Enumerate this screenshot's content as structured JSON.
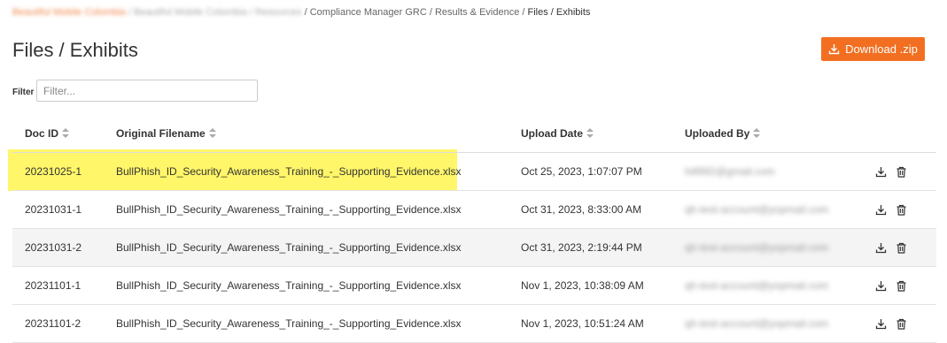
{
  "breadcrumb": {
    "org": "Beautiful Mobile Colombia",
    "client": "Beautiful Mobile Colombia",
    "section": "Resources",
    "path": "/ Compliance Manager GRC / Results & Evidence /",
    "current": "Files / Exhibits"
  },
  "page": {
    "title": "Files / Exhibits",
    "download_label": "Download .zip"
  },
  "filter": {
    "label": "Filter",
    "placeholder": "Filter..."
  },
  "table": {
    "headers": {
      "doc_id": "Doc ID",
      "filename": "Original Filename",
      "upload_date": "Upload Date",
      "uploaded_by": "Uploaded By"
    },
    "rows": [
      {
        "doc_id": "20231025-1",
        "filename": "BullPhish_ID_Security_Awareness_Training_-_Supporting_Evidence.xlsx",
        "upload_date": "Oct 25, 2023, 1:07:07 PM",
        "uploaded_by": "hill992@gmail.com",
        "highlighted": true
      },
      {
        "doc_id": "20231031-1",
        "filename": "BullPhish_ID_Security_Awareness_Training_-_Supporting_Evidence.xlsx",
        "upload_date": "Oct 31, 2023, 8:33:00 AM",
        "uploaded_by": "qh-test-account@yopmail.com"
      },
      {
        "doc_id": "20231031-2",
        "filename": "BullPhish_ID_Security_Awareness_Training_-_Supporting_Evidence.xlsx",
        "upload_date": "Oct 31, 2023, 2:19:44 PM",
        "uploaded_by": "qh-test-account@yopmail.com"
      },
      {
        "doc_id": "20231101-1",
        "filename": "BullPhish_ID_Security_Awareness_Training_-_Supporting_Evidence.xlsx",
        "upload_date": "Nov 1, 2023, 10:38:09 AM",
        "uploaded_by": "qh-test-account@yopmail.com"
      },
      {
        "doc_id": "20231101-2",
        "filename": "BullPhish_ID_Security_Awareness_Training_-_Supporting_Evidence.xlsx",
        "upload_date": "Nov 1, 2023, 10:51:24 AM",
        "uploaded_by": "qh-test-account@yopmail.com"
      }
    ]
  },
  "colors": {
    "accent": "#f26f21",
    "highlight": "#fff44f",
    "stripe": "#f4f4f4"
  },
  "icons": {
    "row_actions": [
      "download-icon",
      "trash-icon"
    ],
    "button": "download-icon"
  }
}
